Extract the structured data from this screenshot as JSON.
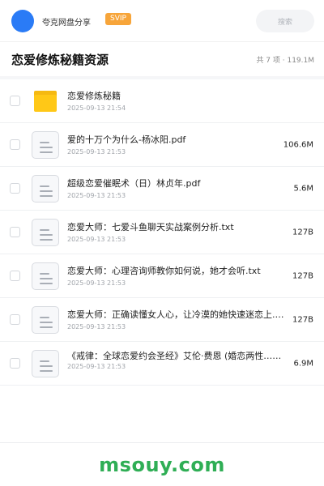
{
  "header": {
    "owner": "夸克网盘分享",
    "badge": "SVIP",
    "search_placeholder": "搜索"
  },
  "folder": {
    "title": "恋爱修炼秘籍资源",
    "summary": "共 7 项 · 119.1M"
  },
  "files": [
    {
      "name": "恋爱修炼秘籍",
      "date": "2025-09-13 21:54",
      "size": "",
      "icon": "folder-icon"
    },
    {
      "name": "爱的十万个为什么-杨冰阳.pdf",
      "date": "2025-09-13 21:53",
      "size": "106.6M",
      "icon": "document-icon"
    },
    {
      "name": "超级恋爱催眠术（日）林贞年.pdf",
      "date": "2025-09-13 21:53",
      "size": "5.6M",
      "icon": "document-icon"
    },
    {
      "name": "恋爱大师：七爱斗鱼聊天实战案例分析.txt",
      "date": "2025-09-13 21:53",
      "size": "127B",
      "icon": "document-icon"
    },
    {
      "name": "恋爱大师：心理咨询师教你如何说，她才会听.txt",
      "date": "2025-09-13 21:53",
      "size": "127B",
      "icon": "document-icon"
    },
    {
      "name": "恋爱大师：正确读懂女人心，让冷漠的她快速迷恋上.t…",
      "date": "2025-09-13 21:53",
      "size": "127B",
      "icon": "document-icon"
    },
    {
      "name": "《戒律：全球恋爱约会圣经》艾伦·费恩 (婚恋两性……",
      "date": "2025-09-13 21:53",
      "size": "6.9M",
      "icon": "document-icon"
    }
  ],
  "footer": {
    "watermark": "msouy.com"
  },
  "colors": {
    "brand_blue": "#2a7bf6",
    "svip_orange": "#f7a53a",
    "folder_yellow": "#ffc817",
    "watermark_green": "#2fae55"
  }
}
